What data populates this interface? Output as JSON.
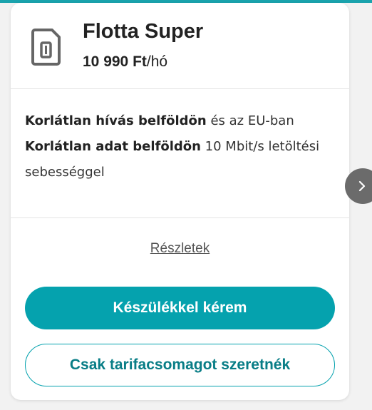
{
  "plan": {
    "icon": "sim-card-icon",
    "name": "Flotta Super",
    "price_amount": "10 990 Ft",
    "price_period": "/hó"
  },
  "features": [
    {
      "bold": "Korlátlan hívás belföldön",
      "rest": " és az EU-ban"
    },
    {
      "bold": "Korlátlan adat belföldön",
      "rest": " 10 Mbit/s letöltési sebességgel"
    }
  ],
  "details_link": "Részletek",
  "buttons": {
    "primary": "Készülékkel kérem",
    "secondary": "Csak tarifacsomagot szeretnék"
  },
  "carousel": {
    "next_icon": "chevron-right-icon"
  },
  "colors": {
    "accent": "#05a2ae",
    "secondary_text": "#087d86"
  }
}
